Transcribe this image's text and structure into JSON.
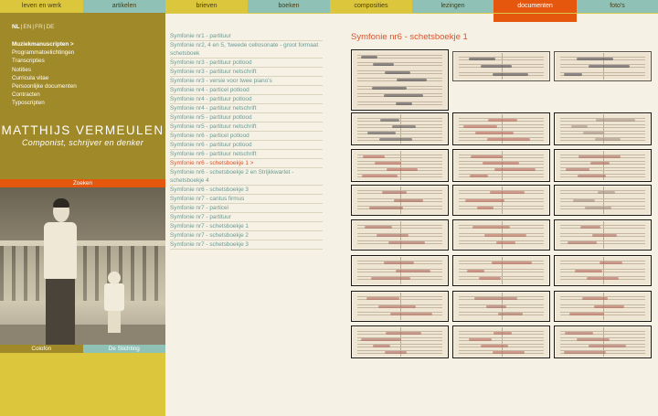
{
  "topnav": [
    {
      "label": "leven en werk",
      "color": "#dcc63c"
    },
    {
      "label": "artikelen",
      "color": "#8fc1b6"
    },
    {
      "label": "brieven",
      "color": "#dcc63c"
    },
    {
      "label": "boeken",
      "color": "#8fc1b6"
    },
    {
      "label": "composities",
      "color": "#dcc63c"
    },
    {
      "label": "lezingen",
      "color": "#8fc1b6"
    },
    {
      "label": "documenten",
      "color": "#e6570e",
      "active": true
    },
    {
      "label": "foto's",
      "color": "#8fc1b6"
    }
  ],
  "languages": [
    {
      "label": "NL",
      "current": true
    },
    {
      "label": "|"
    },
    {
      "label": "EN"
    },
    {
      "label": "|"
    },
    {
      "label": "FR"
    },
    {
      "label": "|"
    },
    {
      "label": "DE"
    }
  ],
  "sidemenu": [
    {
      "label": "Muziekmanuscripten >",
      "current": true
    },
    {
      "label": "Programmatoelichtingen"
    },
    {
      "label": "Transcripties"
    },
    {
      "label": "Notities"
    },
    {
      "label": "Curricula vitae"
    },
    {
      "label": "Persoonlijke documenten"
    },
    {
      "label": "Contracten"
    },
    {
      "label": "Typoscripten"
    }
  ],
  "site": {
    "name": "MATTHIJS VERMEULEN",
    "tagline": "Componist, schrijver en denker",
    "search_label": "Zoeken",
    "footer_left": "Colofon",
    "footer_right": "De Stichting"
  },
  "colors": {
    "sidebar": "#a08929",
    "accent": "#e6570e",
    "teal": "#8fc1b6",
    "yellow": "#dcc63c",
    "link": "#6b9b95",
    "title": "#d9532e"
  },
  "doclist": [
    {
      "label": "Symfonie nr1 - partituur"
    },
    {
      "label": "Symfonie nr2, 4 en 5, 'tweede cellosonate - groot formaat schetsboek"
    },
    {
      "label": "Symfonie nr3 - partituur potlood"
    },
    {
      "label": "Symfonie nr3 - partituur netschrift"
    },
    {
      "label": "Symfonie nr3 - versie voor twee piano's"
    },
    {
      "label": "Symfonie nr4 - particel potlood"
    },
    {
      "label": "Symfonie nr4 - partituur potlood"
    },
    {
      "label": "Symfonie nr4 - partituur netschrift"
    },
    {
      "label": "Symfonie nr5 - partituur potlood"
    },
    {
      "label": "Symfonie nr5 - partituur netschrift"
    },
    {
      "label": "Symfonie nr6 - particel potlood"
    },
    {
      "label": "Symfonie nr6 - partituur potlood"
    },
    {
      "label": "Symfonie nr6 - partituur netschrift"
    },
    {
      "label": "Symfonie nr6 - schetsboekje 1 >",
      "current": true
    },
    {
      "label": "Symfonie nr6 - schetsboekje 2 en Strijkkwartet - schetsboekje 4"
    },
    {
      "label": "Symfonie nr6 - schetsboekje 3"
    },
    {
      "label": "Symfonie nr7 - cantus firmus"
    },
    {
      "label": "Symfonie nr7 - particel"
    },
    {
      "label": "Symfonie nr7 - partituur"
    },
    {
      "label": "Symfonie nr7 - schetsboekje 1"
    },
    {
      "label": "Symfonie nr7 - schetsboekje 2"
    },
    {
      "label": "Symfonie nr7 - schetsboekje 3"
    }
  ],
  "page_title": "Symfonie nr6 - schetsboekje 1",
  "thumbnails": [
    {
      "ink": "#3a3a44"
    },
    {
      "ink": "#3b3b45"
    },
    {
      "ink": "#3d3d48"
    },
    {
      "ink": "#4a4a52"
    },
    {
      "ink": "#b45c52"
    },
    {
      "ink": "#9e8a80"
    },
    {
      "ink": "#b25a50"
    },
    {
      "ink": "#b35b51"
    },
    {
      "ink": "#a86058"
    },
    {
      "ink": "#a35a52"
    },
    {
      "ink": "#b45c52"
    },
    {
      "ink": "#9c8577"
    },
    {
      "ink": "#a65d55"
    },
    {
      "ink": "#b0604f"
    },
    {
      "ink": "#a8625a"
    },
    {
      "ink": "#aa5e56"
    },
    {
      "ink": "#b25a50"
    },
    {
      "ink": "#b05d53"
    },
    {
      "ink": "#ad5f55"
    },
    {
      "ink": "#a46058"
    },
    {
      "ink": "#b05b50"
    },
    {
      "ink": "#a95f56"
    },
    {
      "ink": "#b15c52"
    },
    {
      "ink": "#ab6057"
    }
  ]
}
